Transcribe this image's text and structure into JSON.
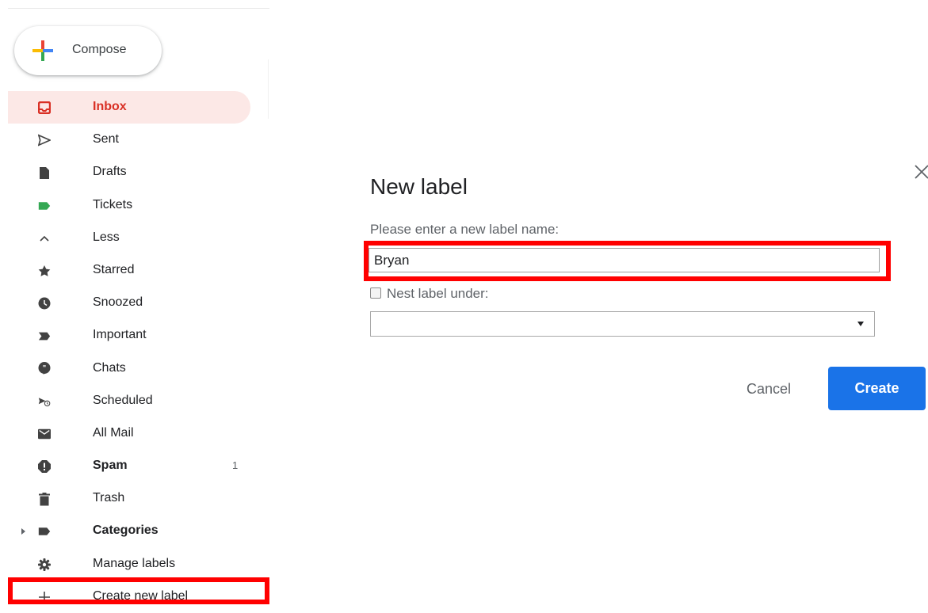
{
  "compose": {
    "label": "Compose"
  },
  "sidebar": {
    "items": [
      {
        "label": "Inbox",
        "icon": "inbox-icon",
        "active": true
      },
      {
        "label": "Sent",
        "icon": "send-icon"
      },
      {
        "label": "Drafts",
        "icon": "draft-icon"
      },
      {
        "label": "Tickets",
        "icon": "label-icon",
        "color": "#34a853"
      },
      {
        "label": "Less",
        "icon": "chevron-up-icon"
      },
      {
        "label": "Starred",
        "icon": "star-icon"
      },
      {
        "label": "Snoozed",
        "icon": "clock-icon"
      },
      {
        "label": "Important",
        "icon": "important-icon"
      },
      {
        "label": "Chats",
        "icon": "chat-icon"
      },
      {
        "label": "Scheduled",
        "icon": "scheduled-send-icon"
      },
      {
        "label": "All Mail",
        "icon": "mail-icon"
      },
      {
        "label": "Spam",
        "icon": "spam-icon",
        "count": "1"
      },
      {
        "label": "Trash",
        "icon": "trash-icon"
      },
      {
        "label": "Categories",
        "icon": "label-icon"
      },
      {
        "label": "Manage labels",
        "icon": "gear-icon"
      },
      {
        "label": "Create new label",
        "icon": "plus-icon"
      }
    ]
  },
  "dialog": {
    "title": "New label",
    "prompt": "Please enter a new label name:",
    "name_value": "Bryan",
    "nest_label": "Nest label under:",
    "nest_selected": "",
    "cancel_label": "Cancel",
    "create_label": "Create"
  },
  "colors": {
    "accent": "#1a73e8",
    "active_text": "#d93025",
    "active_bg": "#fce8e6",
    "highlight": "#ff0000"
  }
}
